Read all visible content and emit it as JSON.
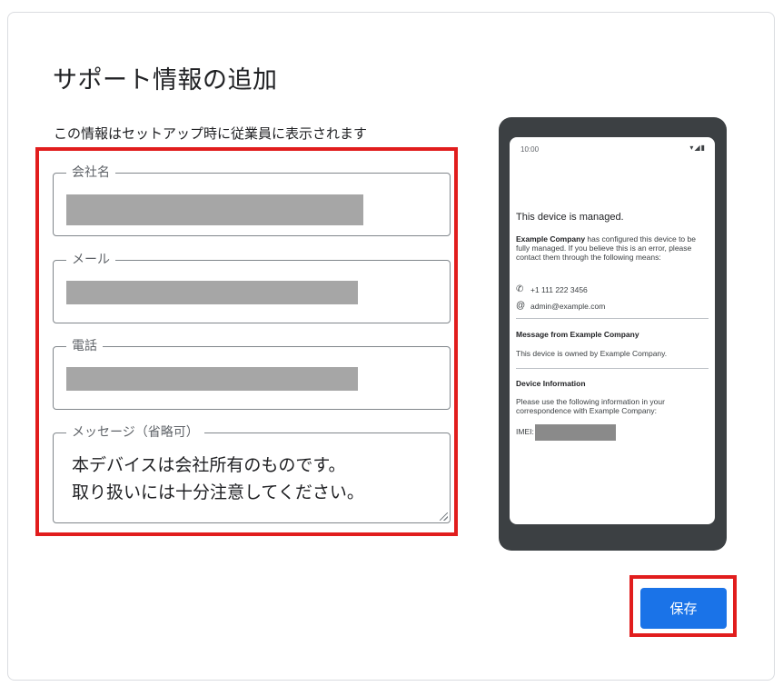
{
  "page": {
    "title": "サポート情報の追加",
    "subtitle": "この情報はセットアップ時に従業員に表示されます"
  },
  "form": {
    "company_label": "会社名",
    "email_label": "メール",
    "phone_label": "電話",
    "message_label": "メッセージ（省略可）",
    "message_value": "本デバイスは会社所有のものです。\n取り扱いには十分注意してください。"
  },
  "preview": {
    "time": "10:00",
    "status_icons": "▾◢▮",
    "heading": "This device is managed.",
    "company_bold": "Example Company",
    "body": " has configured this device to be fully managed. If you believe this is an error, please contact them through the following means:",
    "phone": "+1 111 222 3456",
    "email": "admin@example.com",
    "message_heading": "Message from Example Company",
    "message_body": "This device is owned by Example Company.",
    "device_heading": "Device Information",
    "device_body": "Please use the following information in your correspondence with Example Company:",
    "imei_label": "IMEI:"
  },
  "actions": {
    "save_label": "保存"
  },
  "colors": {
    "accent": "#1a73e8",
    "highlight": "#e11d1d"
  }
}
